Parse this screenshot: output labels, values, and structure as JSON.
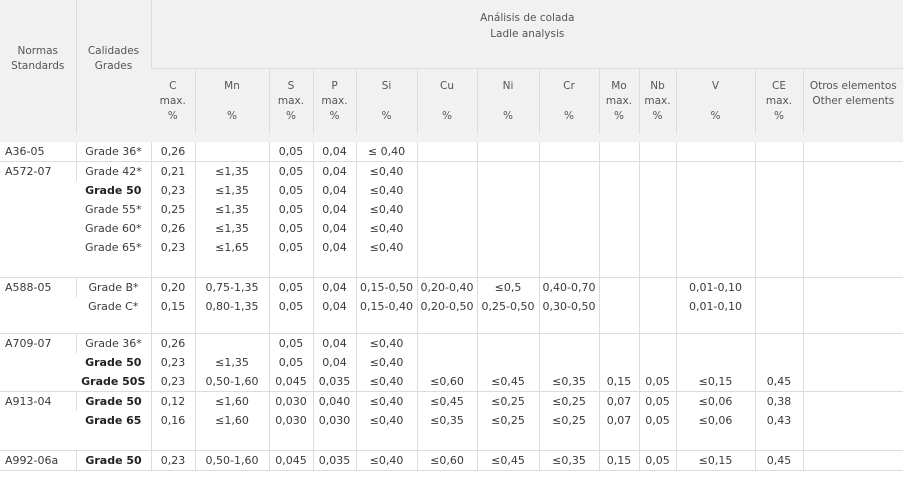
{
  "header": {
    "standards": [
      "Normas",
      "Standards"
    ],
    "grades": [
      "Calidades",
      "Grades"
    ],
    "analysis": [
      "Análisis de colada",
      "Ladle analysis"
    ]
  },
  "columns": [
    {
      "key": "c",
      "lines": [
        "C",
        "max.",
        "%"
      ]
    },
    {
      "key": "mn",
      "lines": [
        "Mn",
        "",
        "%"
      ]
    },
    {
      "key": "s",
      "lines": [
        "S",
        "max.",
        "%"
      ]
    },
    {
      "key": "p",
      "lines": [
        "P",
        "max.",
        "%"
      ]
    },
    {
      "key": "si",
      "lines": [
        "Si",
        "",
        "%"
      ]
    },
    {
      "key": "cu",
      "lines": [
        "Cu",
        "",
        "%"
      ]
    },
    {
      "key": "ni",
      "lines": [
        "Ni",
        "",
        "%"
      ]
    },
    {
      "key": "cr",
      "lines": [
        "Cr",
        "",
        "%"
      ]
    },
    {
      "key": "mo",
      "lines": [
        "Mo",
        "max.",
        "%"
      ]
    },
    {
      "key": "nb",
      "lines": [
        "Nb",
        "max.",
        "%"
      ]
    },
    {
      "key": "v",
      "lines": [
        "V",
        "",
        "%"
      ]
    },
    {
      "key": "ce",
      "lines": [
        "CE",
        "max.",
        "%"
      ]
    },
    {
      "key": "other",
      "lines": [
        "Otros elementos",
        "Other elements",
        ""
      ]
    }
  ],
  "groups": [
    {
      "standard": "A36-05",
      "rows": [
        {
          "grade": "Grade 36*",
          "bold": false,
          "c": "0,26",
          "mn": "",
          "s": "0,05",
          "p": "0,04",
          "si": "≤ 0,40",
          "cu": "",
          "ni": "",
          "cr": "",
          "mo": "",
          "nb": "",
          "v": "",
          "ce": "",
          "other": ""
        }
      ]
    },
    {
      "standard": "A572-07",
      "rows": [
        {
          "grade": "Grade 42*",
          "bold": false,
          "c": "0,21",
          "mn": "≤1,35",
          "s": "0,05",
          "p": "0,04",
          "si": "≤0,40",
          "cu": "",
          "ni": "",
          "cr": "",
          "mo": "",
          "nb": "",
          "v": "",
          "ce": "",
          "other": ""
        },
        {
          "grade": "Grade 50",
          "bold": true,
          "c": "0,23",
          "mn": "≤1,35",
          "s": "0,05",
          "p": "0,04",
          "si": "≤0,40",
          "cu": "",
          "ni": "",
          "cr": "",
          "mo": "",
          "nb": "",
          "v": "",
          "ce": "",
          "other": ""
        },
        {
          "grade": "Grade 55*",
          "bold": false,
          "c": "0,25",
          "mn": "≤1,35",
          "s": "0,05",
          "p": "0,04",
          "si": "≤0,40",
          "cu": "",
          "ni": "",
          "cr": "",
          "mo": "",
          "nb": "",
          "v": "",
          "ce": "",
          "other": ""
        },
        {
          "grade": "Grade 60*",
          "bold": false,
          "c": "0,26",
          "mn": "≤1,35",
          "s": "0,05",
          "p": "0,04",
          "si": "≤0,40",
          "cu": "",
          "ni": "",
          "cr": "",
          "mo": "",
          "nb": "",
          "v": "",
          "ce": "",
          "other": ""
        },
        {
          "grade": "Grade 65*",
          "bold": false,
          "c": "0,23",
          "mn": "≤1,65",
          "s": "0,05",
          "p": "0,04",
          "si": "≤0,40",
          "cu": "",
          "ni": "",
          "cr": "",
          "mo": "",
          "nb": "",
          "v": "",
          "ce": "",
          "other": ""
        }
      ]
    },
    {
      "standard": "A588-05",
      "rows": [
        {
          "grade": "Grade B*",
          "bold": false,
          "c": "0,20",
          "mn": "0,75-1,35",
          "s": "0,05",
          "p": "0,04",
          "si": "0,15-0,50",
          "cu": "0,20-0,40",
          "ni": "≤0,5",
          "cr": "0,40-0,70",
          "mo": "",
          "nb": "",
          "v": "0,01-0,10",
          "ce": "",
          "other": ""
        },
        {
          "grade": "Grade C*",
          "bold": false,
          "c": "0,15",
          "mn": "0,80-1,35",
          "s": "0,05",
          "p": "0,04",
          "si": "0,15-0,40",
          "cu": "0,20-0,50",
          "ni": "0,25-0,50",
          "cr": "0,30-0,50",
          "mo": "",
          "nb": "",
          "v": "0,01-0,10",
          "ce": "",
          "other": ""
        }
      ]
    },
    {
      "standard": "A709-07",
      "rows": [
        {
          "grade": "Grade 36*",
          "bold": false,
          "c": "0,26",
          "mn": "",
          "s": "0,05",
          "p": "0,04",
          "si": "≤0,40",
          "cu": "",
          "ni": "",
          "cr": "",
          "mo": "",
          "nb": "",
          "v": "",
          "ce": "",
          "other": ""
        },
        {
          "grade": "Grade 50",
          "bold": true,
          "c": "0,23",
          "mn": "≤1,35",
          "s": "0,05",
          "p": "0,04",
          "si": "≤0,40",
          "cu": "",
          "ni": "",
          "cr": "",
          "mo": "",
          "nb": "",
          "v": "",
          "ce": "",
          "other": ""
        },
        {
          "grade": "Grade 50S",
          "bold": true,
          "c": "0,23",
          "mn": "0,50-1,60",
          "s": "0,045",
          "p": "0,035",
          "si": "≤0,40",
          "cu": "≤0,60",
          "ni": "≤0,45",
          "cr": "≤0,35",
          "mo": "0,15",
          "nb": "0,05",
          "v": "≤0,15",
          "ce": "0,45",
          "other": ""
        }
      ]
    },
    {
      "standard": "A913-04",
      "rows": [
        {
          "grade": "Grade 50",
          "bold": true,
          "c": "0,12",
          "mn": "≤1,60",
          "s": "0,030",
          "p": "0,040",
          "si": "≤0,40",
          "cu": "≤0,45",
          "ni": "≤0,25",
          "cr": "≤0,25",
          "mo": "0,07",
          "nb": "0,05",
          "v": "≤0,06",
          "ce": "0,38",
          "other": ""
        },
        {
          "grade": "Grade 65",
          "bold": true,
          "c": "0,16",
          "mn": "≤1,60",
          "s": "0,030",
          "p": "0,030",
          "si": "≤0,40",
          "cu": "≤0,35",
          "ni": "≤0,25",
          "cr": "≤0,25",
          "mo": "0,07",
          "nb": "0,05",
          "v": "≤0,06",
          "ce": "0,43",
          "other": ""
        }
      ]
    },
    {
      "standard": "A992-06a",
      "rows": [
        {
          "grade": "Grade 50",
          "bold": true,
          "c": "0,23",
          "mn": "0,50-1,60",
          "s": "0,045",
          "p": "0,035",
          "si": "≤0,40",
          "cu": "≤0,60",
          "ni": "≤0,45",
          "cr": "≤0,35",
          "mo": "0,15",
          "nb": "0,05",
          "v": "≤0,15",
          "ce": "0,45",
          "other": ""
        }
      ]
    }
  ]
}
